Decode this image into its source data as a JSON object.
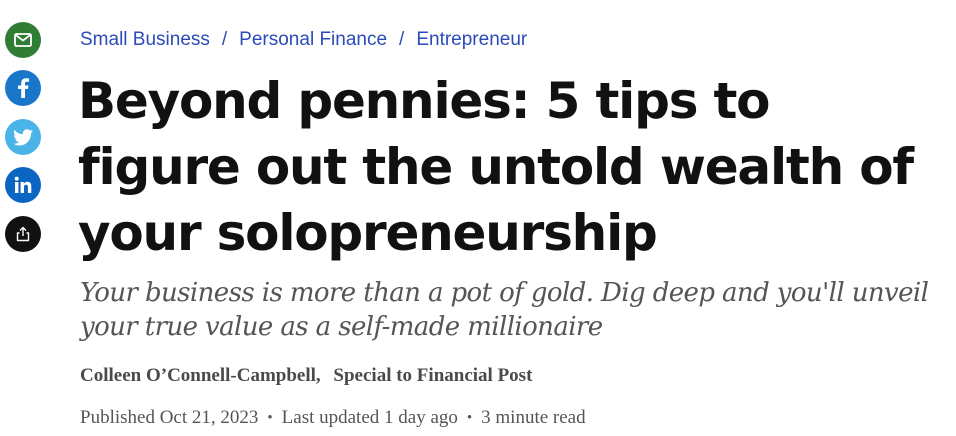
{
  "share": {
    "email_icon": "envelope-icon",
    "facebook_icon": "facebook-icon",
    "twitter_icon": "twitter-icon",
    "linkedin_icon": "linkedin-icon",
    "more_icon": "share-icon",
    "colors": {
      "email": "#2e7d32",
      "facebook": "#1877c8",
      "twitter": "#4ab3e8",
      "linkedin": "#0a66c2",
      "more": "#111111"
    }
  },
  "breadcrumb": {
    "items": [
      "Small Business",
      "Personal Finance",
      "Entrepreneur"
    ],
    "separator": "/"
  },
  "article": {
    "headline": "Beyond pennies: 5 tips to figure out the untold wealth of your solopreneurship",
    "deck": "Your business is more than a pot of gold. Dig deep and you'll unveil your true value as a self-made millionaire",
    "author": "Colleen O’Connell-Campbell",
    "author_affiliation": "Special to Financial Post",
    "published": "Published Oct 21, 2023",
    "updated": "Last updated 1 day ago",
    "read_time": "3 minute read",
    "meta_separator": "•",
    "byline_separator": ","
  }
}
